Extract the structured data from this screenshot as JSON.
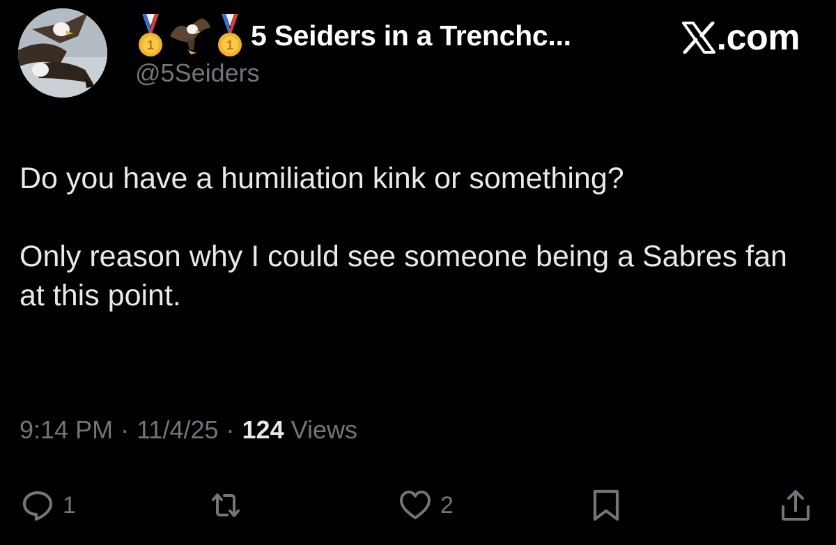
{
  "post": {
    "display_name": "5 Seiders in a Trenchc...",
    "handle": "@5Seiders",
    "name_emojis": [
      "first-place-medal",
      "eagle",
      "first-place-medal"
    ],
    "text_paragraphs": [
      "Do you have a humiliation kink or something?",
      "Only reason why I could see someone being a Sabres fan at this point."
    ],
    "time": "9:14 PM",
    "date": "11/4/25",
    "separator": "·",
    "views_count": "124",
    "views_label": "Views"
  },
  "brand": {
    "icon": "x-logo-icon",
    "domain": ".com"
  },
  "actions": {
    "reply_count": "1",
    "like_count": "2"
  },
  "colors": {
    "background": "#000000",
    "text_primary": "#e7e9ea",
    "text_secondary": "#71767b"
  }
}
